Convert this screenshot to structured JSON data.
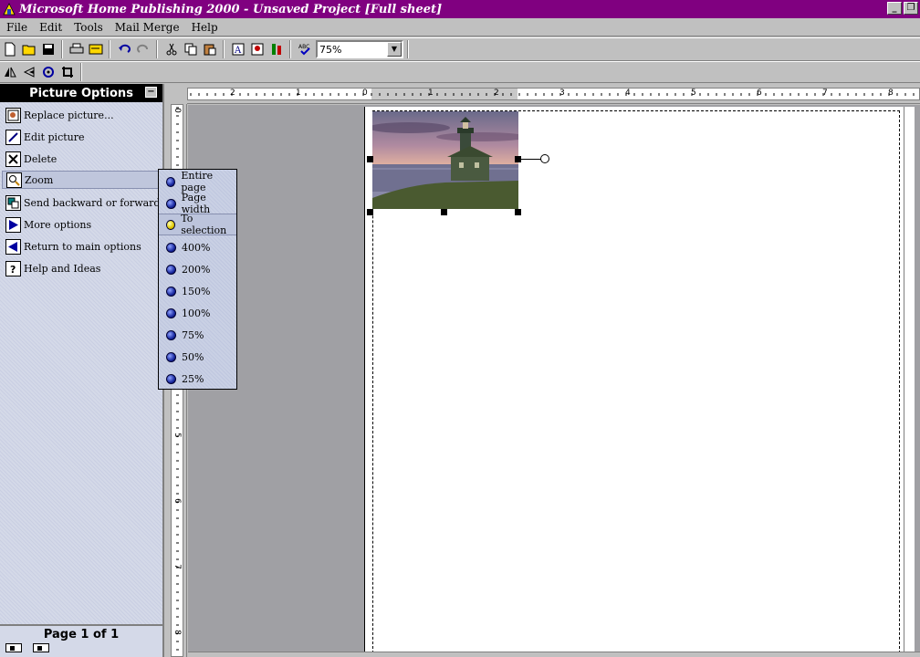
{
  "window": {
    "title": "Microsoft Home Publishing 2000 - Unsaved Project [Full sheet]",
    "minimize_glyph": "_",
    "restore_glyph": "❐"
  },
  "menu": [
    "File",
    "Edit",
    "Tools",
    "Mail Merge",
    "Help"
  ],
  "toolbar": {
    "zoom_value": "75%",
    "icons": [
      "new-icon",
      "open-icon",
      "save-icon",
      "print-icon",
      "print-preview-icon",
      "undo-icon",
      "redo-icon",
      "cut-icon",
      "copy-icon",
      "paste-icon",
      "text-box-icon",
      "insert-picture-icon",
      "format-painter-icon",
      "spelling-icon"
    ],
    "format_icons": [
      "flip-icon",
      "rotate-left-icon",
      "rotate-icon",
      "crop-icon"
    ]
  },
  "left_panel": {
    "header": "Picture Options",
    "close_glyph": "−",
    "options": [
      {
        "label": "Replace picture...",
        "icon": "replace-picture-icon"
      },
      {
        "label": "Edit picture",
        "icon": "edit-pencil-icon"
      },
      {
        "label": "Delete",
        "icon": "delete-x-icon"
      },
      {
        "label": "Zoom",
        "icon": "magnifier-icon"
      },
      {
        "label": "Send backward or forward",
        "icon": "layer-order-icon"
      },
      {
        "label": "More options",
        "icon": "arrow-right-icon"
      },
      {
        "label": "Return to main options",
        "icon": "arrow-left-icon"
      },
      {
        "label": "Help and Ideas",
        "icon": "help-icon"
      }
    ],
    "footer": "Page 1 of 1"
  },
  "zoom_submenu": {
    "items": [
      "Entire page",
      "Page width",
      "To selection",
      "400%",
      "200%",
      "150%",
      "100%",
      "75%",
      "50%",
      "25%"
    ],
    "selected": "To selection"
  },
  "ruler": {
    "horizontal_labels": [
      "2",
      "1",
      "0",
      "1",
      "2",
      "3",
      "4",
      "5",
      "6",
      "7",
      "8"
    ],
    "vertical_labels": [
      "0",
      "5",
      "6",
      "7",
      "8"
    ]
  },
  "colors": {
    "title_bar": "#800080",
    "panel_bg": "#d4d9e8",
    "workspace": "#a0a0a4"
  }
}
